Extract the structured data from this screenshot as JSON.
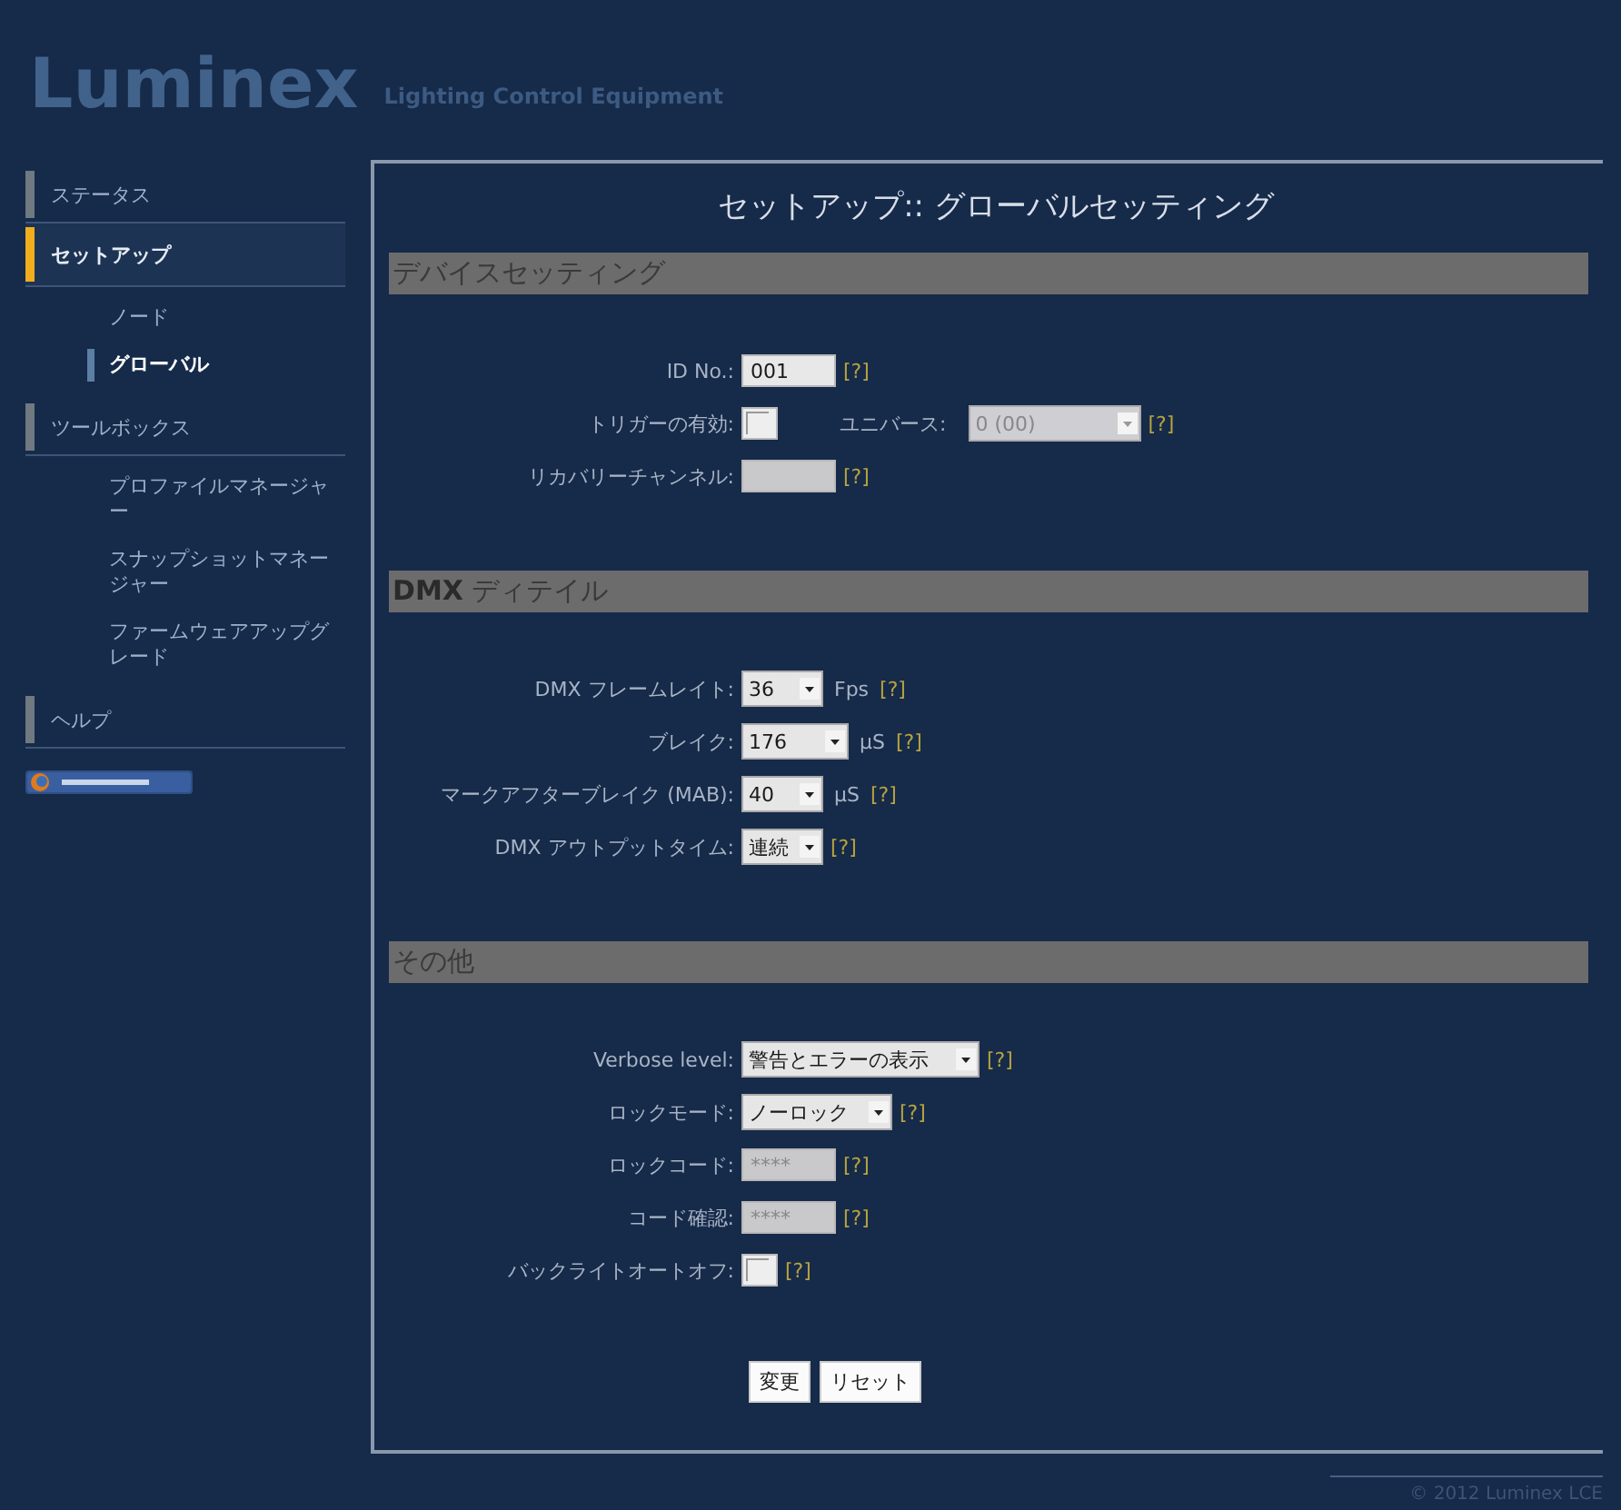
{
  "header": {
    "logo": "Luminex",
    "tagline": "Lighting Control Equipment"
  },
  "sidebar": {
    "items": [
      {
        "label": "ステータス",
        "selected": false
      },
      {
        "label": "セットアップ",
        "selected": true,
        "children": [
          {
            "label": "ノード",
            "selected": false
          },
          {
            "label": "グローバル",
            "selected": true
          }
        ]
      },
      {
        "label": "ツールボックス",
        "selected": false,
        "children": [
          {
            "label": "プロファイルマネージャー",
            "selected": false
          },
          {
            "label": "スナップショットマネージャー",
            "selected": false
          },
          {
            "label": "ファームウェアアップグレード",
            "selected": false
          }
        ]
      },
      {
        "label": "ヘルプ",
        "selected": false
      }
    ]
  },
  "panel": {
    "title": "セットアップ:: グローバルセッティング",
    "sections": [
      {
        "title": "デバイスセッティング",
        "rows": [
          {
            "label": "ID No.:",
            "controls": [
              {
                "kind": "text",
                "value": "001",
                "disabled": false
              },
              {
                "kind": "help",
                "text": "[?]"
              }
            ]
          },
          {
            "label": "トリガーの有効:",
            "controls": [
              {
                "kind": "checkbox",
                "checked": false
              },
              {
                "kind": "label",
                "text": "ユニバース:"
              },
              {
                "kind": "select",
                "value": "0 (00)",
                "disabled": true
              },
              {
                "kind": "help",
                "text": "[?]"
              }
            ]
          },
          {
            "label": "リカバリーチャンネル:",
            "controls": [
              {
                "kind": "text",
                "disabled": true
              },
              {
                "kind": "help",
                "text": "[?]"
              }
            ]
          }
        ]
      },
      {
        "title": "**DMX** ディテイル",
        "rows": [
          {
            "label": "DMX フレームレイト:",
            "controls": [
              {
                "kind": "select",
                "value": "36",
                "disabled": false
              },
              {
                "kind": "unit",
                "text": "Fps"
              },
              {
                "kind": "help",
                "text": "[?]"
              }
            ]
          },
          {
            "label": "ブレイク:",
            "controls": [
              {
                "kind": "select",
                "value": "176",
                "disabled": false
              },
              {
                "kind": "unit",
                "text": "μS"
              },
              {
                "kind": "help",
                "text": "[?]"
              }
            ]
          },
          {
            "label": "マークアフターブレイク (MAB):",
            "controls": [
              {
                "kind": "select",
                "value": "40",
                "disabled": false
              },
              {
                "kind": "unit",
                "text": "μS"
              },
              {
                "kind": "help",
                "text": "[?]"
              }
            ]
          },
          {
            "label": "DMX アウトプットタイム:",
            "controls": [
              {
                "kind": "select",
                "value": "連続",
                "disabled": false
              },
              {
                "kind": "help",
                "text": "[?]"
              }
            ]
          }
        ]
      },
      {
        "title": "その他",
        "rows": [
          {
            "label": "Verbose level:",
            "controls": [
              {
                "kind": "select",
                "value": "警告とエラーの表示",
                "disabled": false
              },
              {
                "kind": "help",
                "text": "[?]"
              }
            ]
          },
          {
            "label": "ロックモード:",
            "controls": [
              {
                "kind": "select",
                "value": "ノーロック",
                "disabled": false
              },
              {
                "kind": "help",
                "text": "[?]"
              }
            ]
          },
          {
            "label": "ロックコード:",
            "controls": [
              {
                "kind": "text",
                "placeholder": "****",
                "disabled": true
              },
              {
                "kind": "help",
                "text": "[?]"
              }
            ]
          },
          {
            "label": "コード確認:",
            "controls": [
              {
                "kind": "text",
                "placeholder": "****",
                "disabled": true
              },
              {
                "kind": "help",
                "text": "[?]"
              }
            ]
          },
          {
            "label": "バックライトオートオフ:",
            "controls": [
              {
                "kind": "checkbox",
                "checked": false
              },
              {
                "kind": "help",
                "text": "[?]"
              }
            ]
          }
        ]
      }
    ],
    "buttons": [
      "変更",
      "リセット"
    ]
  },
  "footer": "© 2012 Luminex LCE"
}
